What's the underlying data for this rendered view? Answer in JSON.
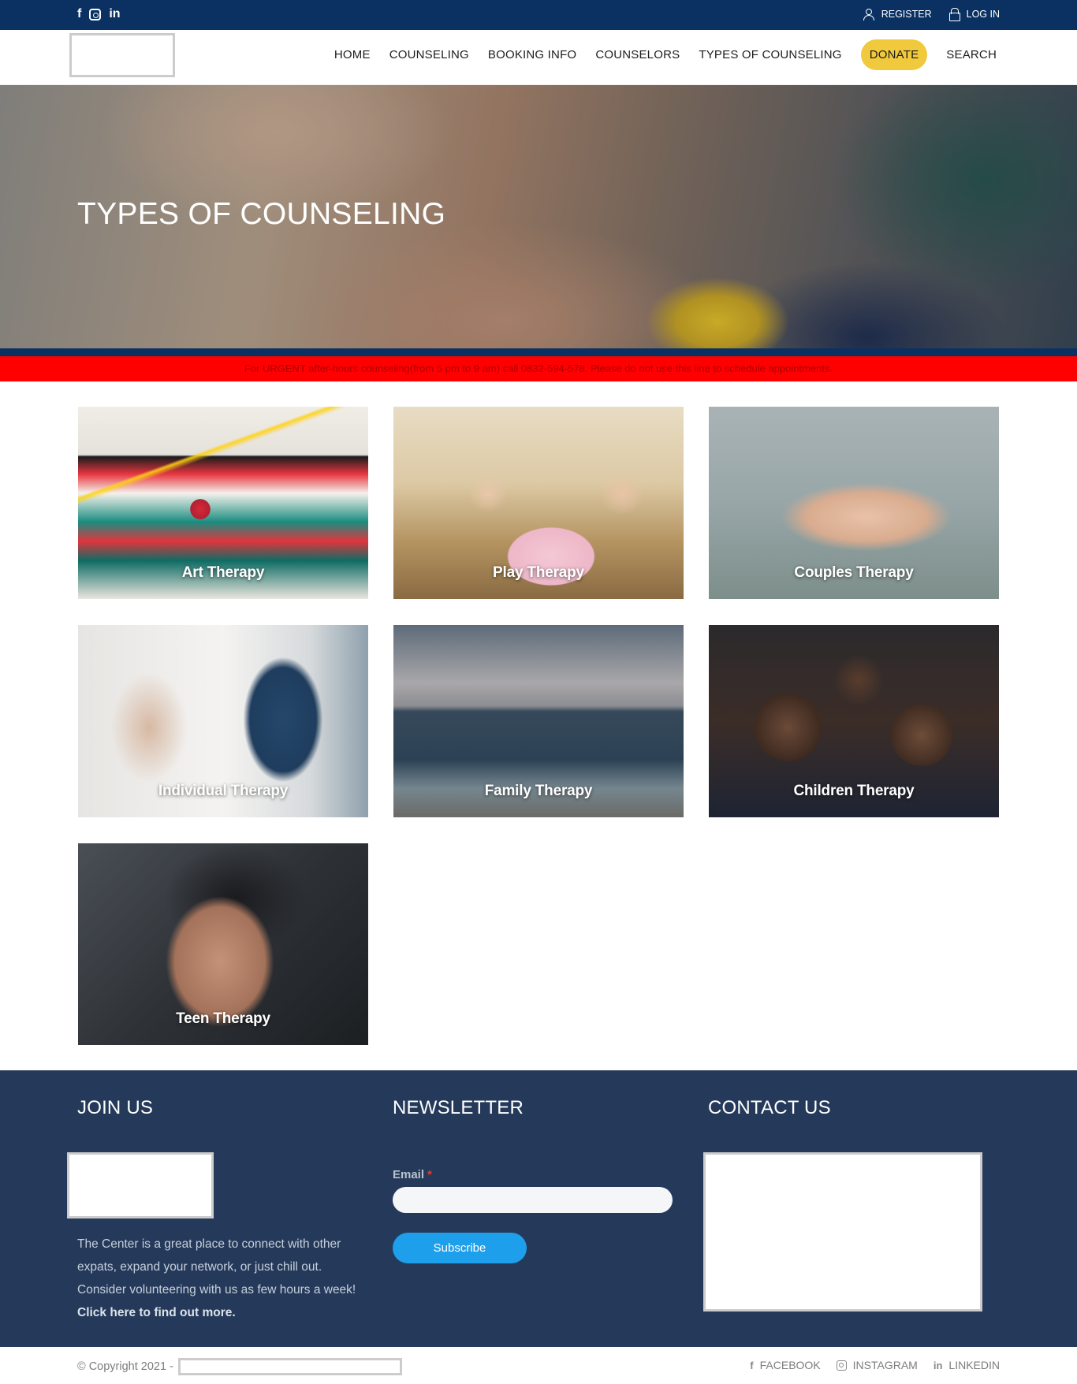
{
  "topbar": {
    "social": [
      {
        "icon": "facebook-icon",
        "glyph": "f"
      },
      {
        "icon": "instagram-icon",
        "glyph": ""
      },
      {
        "icon": "linkedin-icon",
        "glyph": "in"
      }
    ],
    "register_label": "REGISTER",
    "login_label": "LOG IN"
  },
  "nav": {
    "items": [
      {
        "label": "HOME"
      },
      {
        "label": "COUNSELING"
      },
      {
        "label": "BOOKING INFO"
      },
      {
        "label": "COUNSELORS"
      },
      {
        "label": "TYPES OF COUNSELING"
      },
      {
        "label": "DONATE"
      },
      {
        "label": "SEARCH"
      }
    ]
  },
  "hero": {
    "title": "TYPES OF COUNSELING"
  },
  "urgent": {
    "text": "For URGENT after-hours counseling(from 5 pm to 9 am) call 0832-594-578. Please do not use this line to schedule appointments."
  },
  "therapies": [
    {
      "label": "Art Therapy"
    },
    {
      "label": "Play Therapy"
    },
    {
      "label": "Couples Therapy"
    },
    {
      "label": "Individual Therapy"
    },
    {
      "label": "Family Therapy"
    },
    {
      "label": "Children Therapy"
    },
    {
      "label": "Teen Therapy"
    }
  ],
  "footer": {
    "join": {
      "title": "JOIN US",
      "text": "The Center is a great place to connect with other expats, expand your network, or just chill out. Consider volunteering with us as few hours a week!",
      "more_link": "Click here to find out more."
    },
    "newsletter": {
      "title": "NEWSLETTER",
      "email_label": "Email",
      "required_mark": "*",
      "email_value": "",
      "subscribe_label": "Subscribe"
    },
    "contact": {
      "title": "CONTACT US"
    }
  },
  "bottom": {
    "copyright": "© Copyright 2021 -",
    "links": [
      {
        "icon": "facebook-icon",
        "label": "FACEBOOK"
      },
      {
        "icon": "instagram-icon",
        "label": "INSTAGRAM"
      },
      {
        "icon": "linkedin-icon",
        "label": "LINKEDIN"
      }
    ]
  },
  "colors": {
    "topbar": "#0a3161",
    "donate": "#f0c93c",
    "urgent": "#fe0000",
    "footer": "#253a5a",
    "subscribe": "#1e9fec"
  }
}
